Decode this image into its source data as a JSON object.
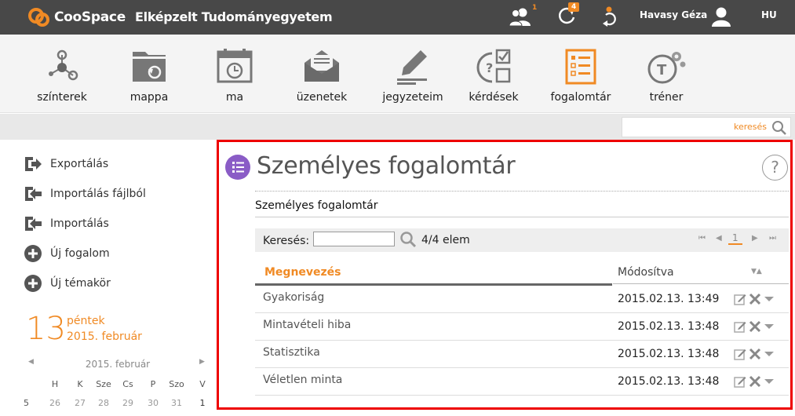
{
  "app": {
    "name": "CooSpace",
    "org": "Elképzelt Tudományegyetem"
  },
  "topbar": {
    "users_badge": "1",
    "refresh_badge": "4",
    "user_name": "Havasy Géza",
    "language": "HU",
    "accent_color": "#f08a24"
  },
  "toolbar": {
    "items": [
      {
        "label": "színterek",
        "icon": "network-icon"
      },
      {
        "label": "mappa",
        "icon": "folder-icon"
      },
      {
        "label": "ma",
        "icon": "calendar-icon"
      },
      {
        "label": "üzenetek",
        "icon": "envelope-icon"
      },
      {
        "label": "jegyzeteim",
        "icon": "pencil-icon"
      },
      {
        "label": "kérdések",
        "icon": "quiz-icon"
      },
      {
        "label": "fogalomtár",
        "icon": "glossary-icon"
      },
      {
        "label": "tréner",
        "icon": "trainer-icon"
      }
    ]
  },
  "search": {
    "label": "keresés",
    "value": ""
  },
  "sidebar": {
    "items": [
      {
        "label": "Exportálás"
      },
      {
        "label": "Importálás fájlból"
      },
      {
        "label": "Importálás"
      },
      {
        "label": "Új fogalom"
      },
      {
        "label": "Új témakör"
      }
    ]
  },
  "calendar": {
    "day": "13",
    "weekday": "péntek",
    "date_text": "2015. február",
    "month_label": "2015. február",
    "dow": [
      "H",
      "K",
      "Sze",
      "Cs",
      "P",
      "Szo",
      "V"
    ],
    "week_number": "5",
    "first_row": [
      "26",
      "27",
      "28",
      "29",
      "30",
      "31",
      "1"
    ]
  },
  "main": {
    "title": "Személyes fogalomtár",
    "help": "?",
    "subtitle": "Személyes fogalomtár",
    "list": {
      "search_label": "Keresés:",
      "search_value": "",
      "count": "4/4 elem",
      "current_page": "1",
      "columns": {
        "name": "Megnevezés",
        "modified": "Módosítva"
      },
      "rows": [
        {
          "name": "Gyakoriság",
          "modified": "2015.02.13. 13:49"
        },
        {
          "name": "Mintavételi hiba",
          "modified": "2015.02.13. 13:48"
        },
        {
          "name": "Statisztika",
          "modified": "2015.02.13. 13:48"
        },
        {
          "name": "Véletlen minta",
          "modified": "2015.02.13. 13:48"
        }
      ]
    }
  }
}
